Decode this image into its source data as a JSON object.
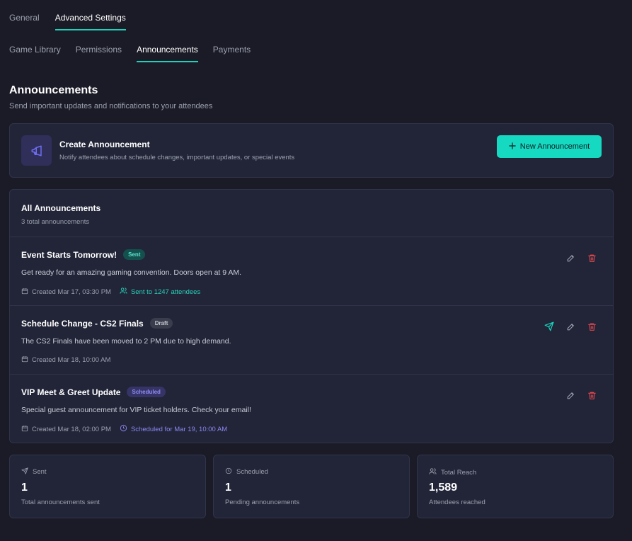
{
  "primary_tabs": [
    {
      "label": "General",
      "active": false
    },
    {
      "label": "Advanced Settings",
      "active": true
    }
  ],
  "secondary_tabs": [
    {
      "label": "Game Library",
      "active": false
    },
    {
      "label": "Permissions",
      "active": false
    },
    {
      "label": "Announcements",
      "active": true
    },
    {
      "label": "Payments",
      "active": false
    }
  ],
  "page": {
    "title": "Announcements",
    "subtitle": "Send important updates and notifications to your attendees"
  },
  "create": {
    "icon": "megaphone-icon",
    "title": "Create Announcement",
    "description": "Notify attendees about schedule changes, important updates, or special events",
    "button_label": "New Announcement"
  },
  "list": {
    "title": "All Announcements",
    "count": "3 total announcements",
    "items": [
      {
        "title": "Event Starts Tomorrow!",
        "status": "Sent",
        "description": "Get ready for an amazing gaming convention. Doors open at 9 AM.",
        "created": "Created Mar 17, 03:30 PM",
        "extra": "Sent to 1247 attendees"
      },
      {
        "title": "Schedule Change - CS2 Finals",
        "status": "Draft",
        "description": "The CS2 Finals have been moved to 2 PM due to high demand.",
        "created": "Created Mar 18, 10:00 AM",
        "extra": ""
      },
      {
        "title": "VIP Meet & Greet Update",
        "status": "Scheduled",
        "description": "Special guest announcement for VIP ticket holders. Check your email!",
        "created": "Created Mar 18, 02:00 PM",
        "extra": "Scheduled for Mar 19, 10:00 AM"
      }
    ]
  },
  "stats": [
    {
      "label": "Sent",
      "value": "1",
      "description": "Total announcements sent",
      "icon": "send-icon"
    },
    {
      "label": "Scheduled",
      "value": "1",
      "description": "Pending announcements",
      "icon": "clock-icon"
    },
    {
      "label": "Total Reach",
      "value": "1,589",
      "description": "Attendees reached",
      "icon": "users-icon"
    }
  ],
  "colors": {
    "accent": "#16d9c1",
    "danger": "#e5484d",
    "scheduled": "#8c86f2"
  }
}
